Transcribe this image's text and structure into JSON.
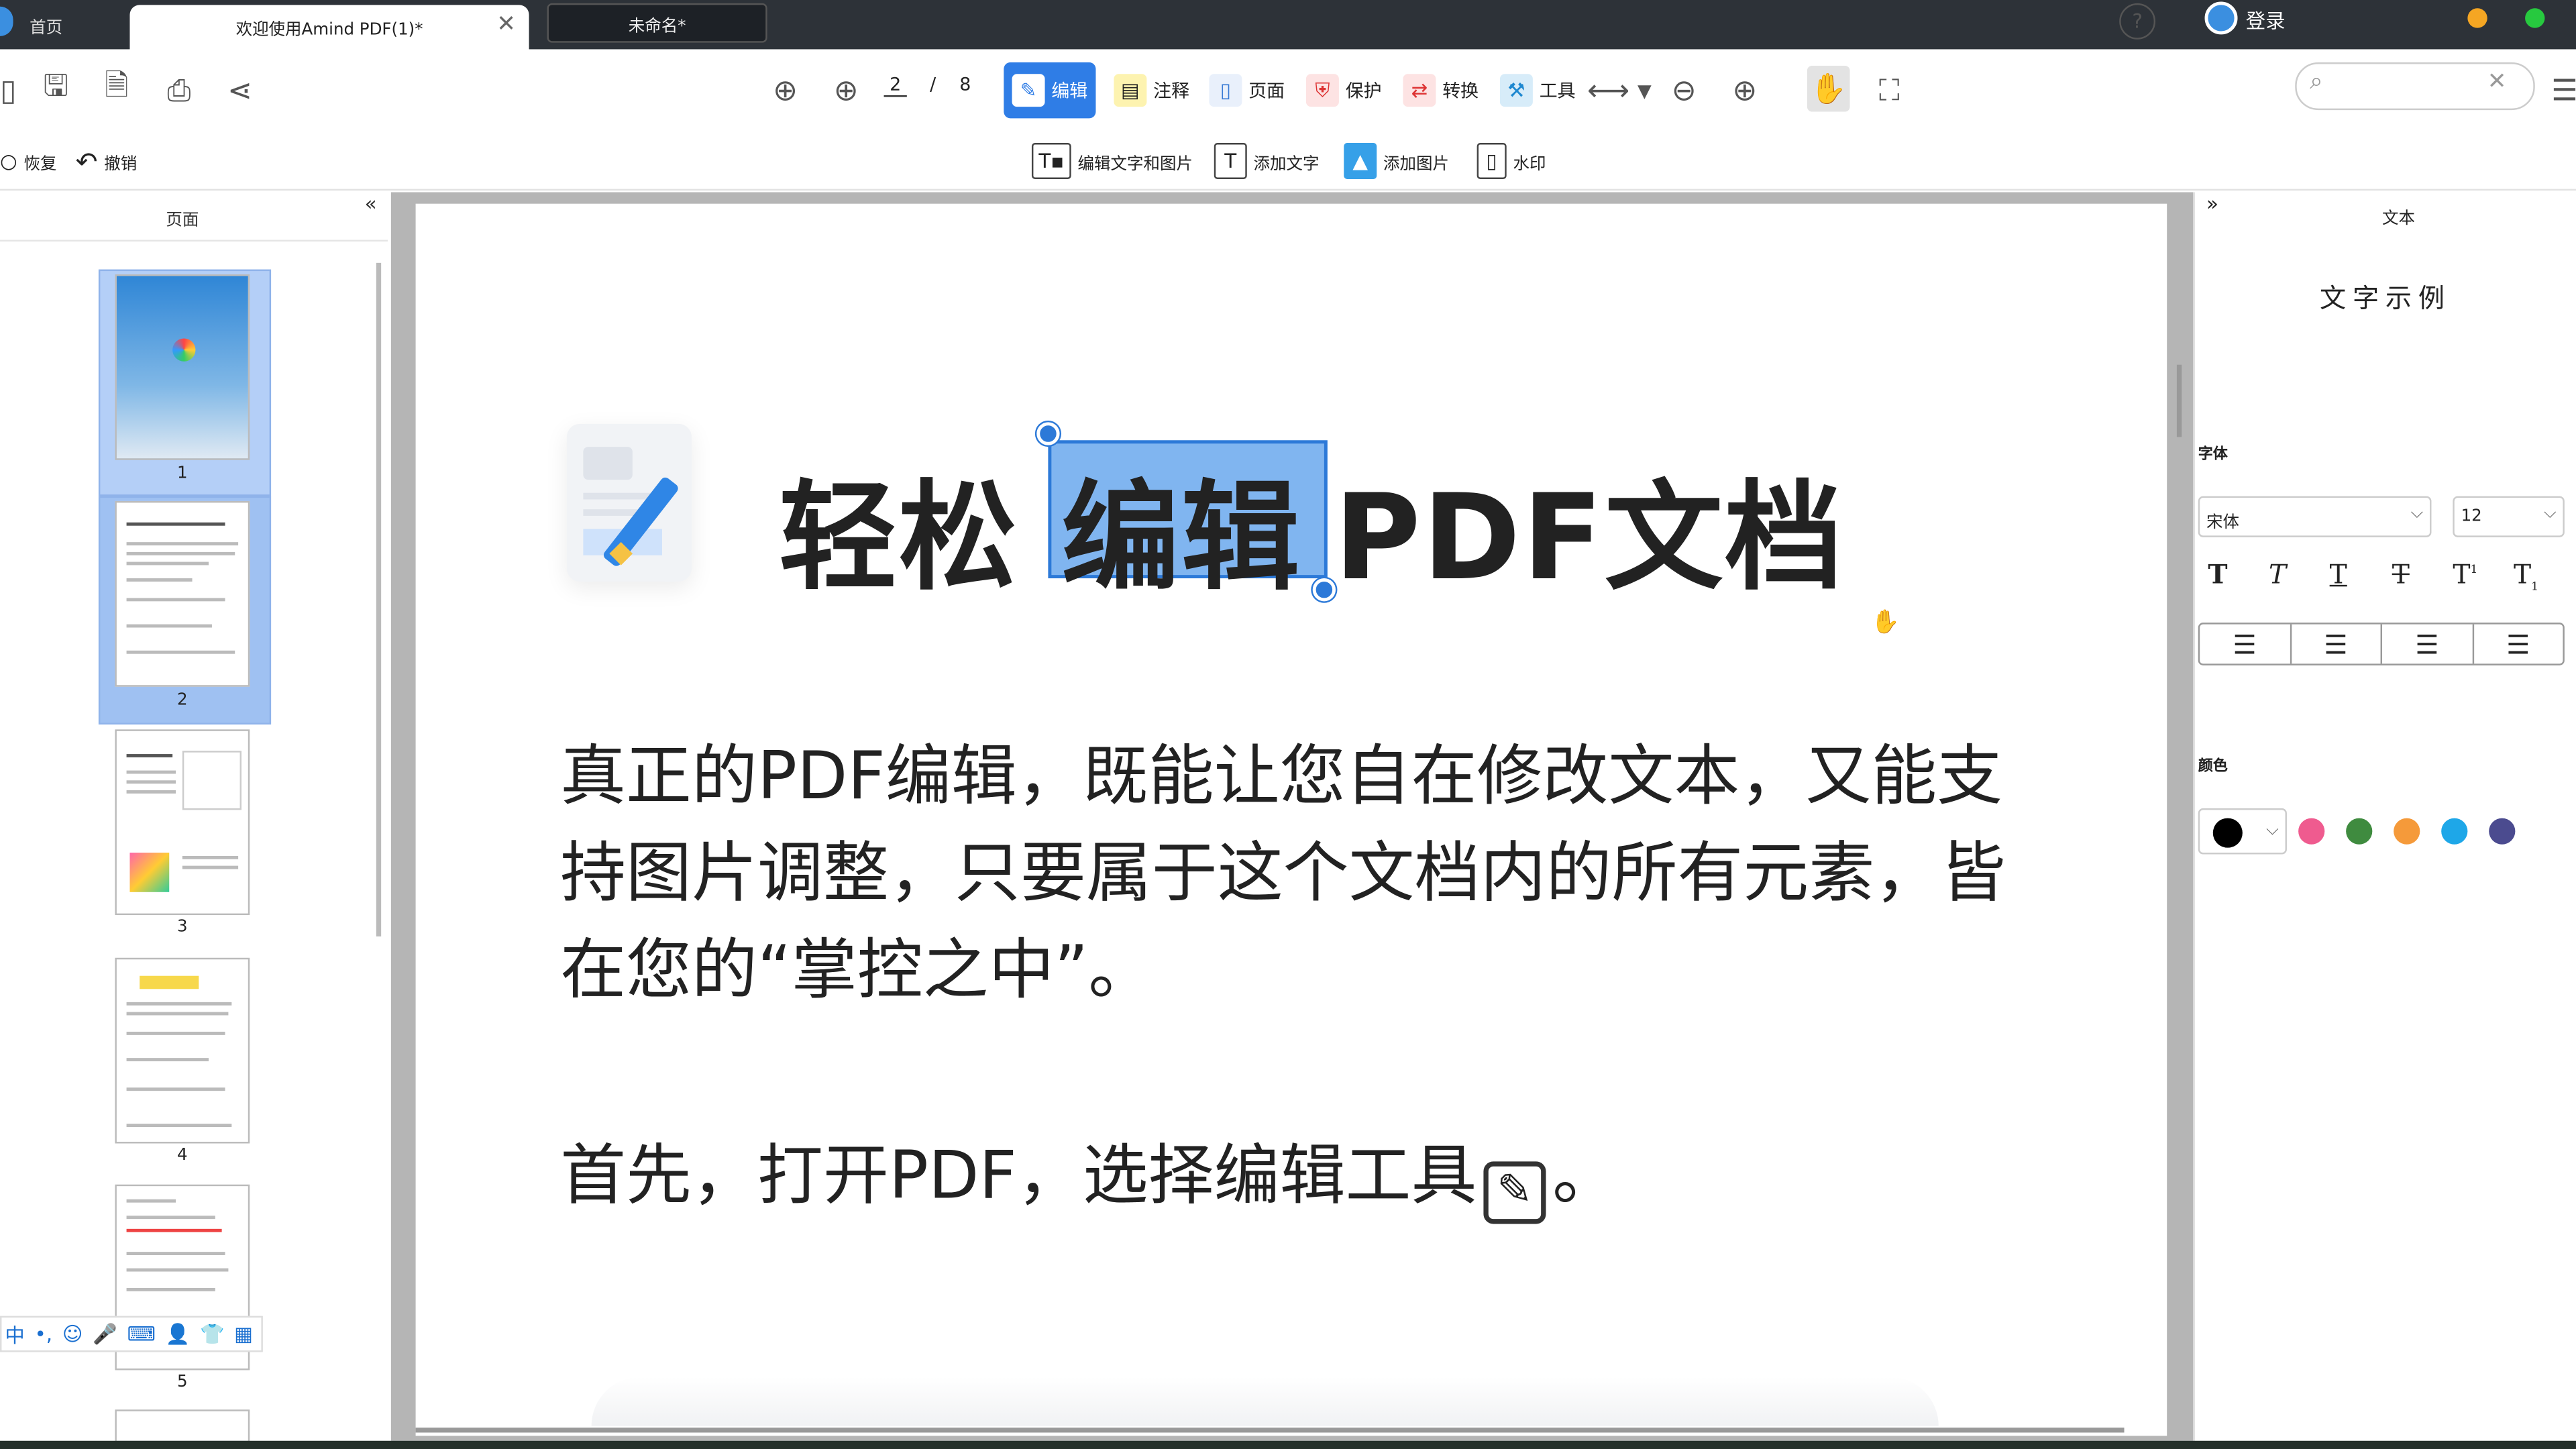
{
  "tabs": {
    "home": "首页",
    "document": "欢迎使用Amind PDF(1)*",
    "unnamed": "未命名*"
  },
  "titlebar": {
    "login": "登录",
    "help": "?"
  },
  "toolbar": {
    "page_current": "2",
    "page_separator": "/",
    "page_total": "8",
    "modes": [
      {
        "label": "编辑",
        "icon": "edit-icon"
      },
      {
        "label": "注释",
        "icon": "note-icon"
      },
      {
        "label": "页面",
        "icon": "page-icon"
      },
      {
        "label": "保护",
        "icon": "protect-icon"
      },
      {
        "label": "转换",
        "icon": "convert-icon"
      },
      {
        "label": "工具",
        "icon": "tools-icon"
      }
    ]
  },
  "toolbar2": {
    "restore": "恢复",
    "undo": "撤销",
    "edit_text_image": "编辑文字和图片",
    "add_text": "添加文字",
    "add_image": "添加图片",
    "watermark": "水印"
  },
  "left_panel": {
    "title": "页面",
    "thumbs": [
      "1",
      "2",
      "3",
      "4",
      "5"
    ]
  },
  "document": {
    "title_before": "轻松",
    "title_selected": "编辑",
    "title_after": "PDF文档",
    "paragraph1": "真正的PDF编辑，既能让您自在修改文本，又能支持图片调整，只要属于这个文档内的所有元素，皆在您的“掌控之中”。",
    "paragraph2": "首先，打开PDF，选择编辑工具",
    "paragraph2_end": "。"
  },
  "right_panel": {
    "title": "文本",
    "sample": "文字示例",
    "font_label": "字体",
    "font_value": "宋体",
    "size_value": "12",
    "color_label": "颜色",
    "style_buttons": [
      "T",
      "T",
      "T",
      "T",
      "T",
      "T"
    ],
    "colors": [
      "#000000",
      "#ef5b8f",
      "#3f8b3f",
      "#f59a3a",
      "#1ea7e8",
      "#4b4b8f"
    ]
  }
}
